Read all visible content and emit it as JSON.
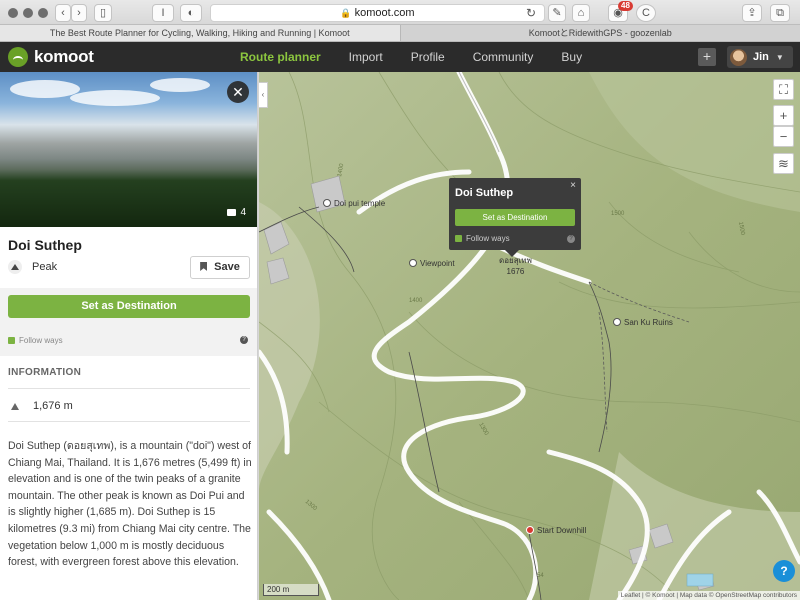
{
  "browser": {
    "url": "komoot.com",
    "extension_badge": "48",
    "tabs": [
      {
        "label": "The Best Route Planner for Cycling, Walking, Hiking and Running | Komoot",
        "active": true
      },
      {
        "label": "KomootとRidewithGPS - goozenlab",
        "active": false
      }
    ]
  },
  "header": {
    "logo_text": "komoot",
    "nav": [
      "Route planner",
      "Import",
      "Profile",
      "Community",
      "Buy"
    ],
    "active_nav": "Route planner",
    "add_label": "+",
    "user_name": "Jin"
  },
  "sidebar": {
    "photo_count": "4",
    "title": "Doi Suthep",
    "type": "Peak",
    "save_label": "Save",
    "destination_label": "Set as Destination",
    "follow_label": "Follow ways",
    "info_header": "INFORMATION",
    "elevation": "1,676 m",
    "description": "Doi Suthep (ดอยสุเทพ), is a mountain (\"doi\") west of Chiang Mai, Thailand. It is 1,676 metres (5,499 ft) in elevation and is one of the twin peaks of a granite mountain. The other peak is known as Doi Pui and is slightly higher (1,685 m). Doi Suthep is 15 kilometres (9.3 mi) from Chiang Mai city centre. The vegetation below 1,000 m is mostly deciduous forest, with evergreen forest above this elevation."
  },
  "map": {
    "popup": {
      "title": "Doi Suthep",
      "close": "×",
      "button": "Set as Destination",
      "follow": "Follow ways"
    },
    "labels": {
      "temple": "Doi pui temple",
      "viewpoint": "Viewpoint",
      "peak_name": "ดอยสุเทพ",
      "peak_elev": "1676",
      "ruins": "San Ku Ruins",
      "start": "Start Downhill"
    },
    "contours": [
      "1400",
      "1500",
      "1500",
      "1300",
      "1300",
      "1400",
      "54"
    ],
    "scale": "200 m",
    "attribution": "Leaflet | © Komoot | Map data © OpenStreetMap contributors",
    "controls": {
      "zoom_in": "+",
      "zoom_out": "−",
      "help": "?"
    }
  },
  "colors": {
    "brand_green": "#7cb342",
    "nav_active": "#8cc63f",
    "header_bg": "#2b2b2b",
    "map_bg": "#a7b583",
    "help_blue": "#1a8fd8"
  }
}
